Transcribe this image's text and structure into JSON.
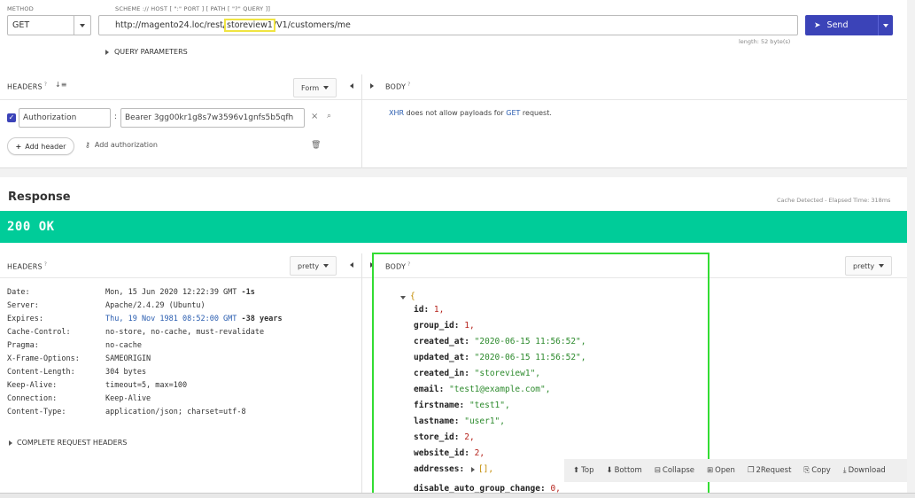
{
  "request": {
    "method_label": "METHOD",
    "method": "GET",
    "url_label": "SCHEME :// HOST [ \":\" PORT ] [ PATH [ \"?\" QUERY ]]",
    "url_prefix": "http://magento24.loc/rest/",
    "url_highlight": "storeview1",
    "url_suffix": "/V1/customers/me",
    "length": "length: 52 byte(s)",
    "send_label": "Send",
    "query_params_label": "QUERY PARAMETERS",
    "headers_label": "HEADERS",
    "headers_sup": "?",
    "form_label": "Form",
    "body_label": "BODY",
    "body_sup": "?",
    "header_name": "Authorization",
    "header_value": "Bearer 3gg00kr1g8s7w3596v1gnfs5b5qfh",
    "add_header_label": "Add header",
    "add_auth_label": "Add authorization",
    "xhr_prefix": "XHR",
    "xhr_middle": " does not allow payloads for ",
    "xhr_method": "GET",
    "xhr_suffix": " request."
  },
  "response": {
    "title": "Response",
    "cache_info": "Cache Detected - Elapsed Time: 318ms",
    "status": "200 OK",
    "headers_label": "HEADERS",
    "headers_sup": "?",
    "pretty_label": "pretty",
    "body_label": "BODY",
    "body_sup": "?",
    "headers": [
      {
        "key": "Date:",
        "value": "Mon, 15 Jun 2020 12:22:39 GMT",
        "extra": "-1s"
      },
      {
        "key": "Server:",
        "value": "Apache/2.4.29 (Ubuntu)",
        "extra": ""
      },
      {
        "key": "Expires:",
        "value": "Thu, 19 Nov 1981 08:52:00 GMT",
        "extra": "-38 years"
      },
      {
        "key": "Cache-Control:",
        "value": "no-store, no-cache, must-revalidate",
        "extra": ""
      },
      {
        "key": "Pragma:",
        "value": "no-cache",
        "extra": ""
      },
      {
        "key": "X-Frame-Options:",
        "value": "SAMEORIGIN",
        "extra": ""
      },
      {
        "key": "Content-Length:",
        "value": "304 bytes",
        "extra": ""
      },
      {
        "key": "Keep-Alive:",
        "value": "timeout=5, max=100",
        "extra": ""
      },
      {
        "key": "Connection:",
        "value": "Keep-Alive",
        "extra": ""
      },
      {
        "key": "Content-Type:",
        "value": "application/json; charset=utf-8",
        "extra": ""
      }
    ],
    "complete_headers_label": "COMPLETE REQUEST HEADERS",
    "json_open": "{",
    "json": [
      {
        "key": "id:",
        "value": "1,",
        "kind": "num"
      },
      {
        "key": "group_id:",
        "value": "1,",
        "kind": "num"
      },
      {
        "key": "created_at:",
        "value": "\"2020-06-15 11:56:52\",",
        "kind": "str"
      },
      {
        "key": "updated_at:",
        "value": "\"2020-06-15 11:56:52\",",
        "kind": "str"
      },
      {
        "key": "created_in:",
        "value": "\"storeview1\",",
        "kind": "str"
      },
      {
        "key": "email:",
        "value": "\"test1@example.com\",",
        "kind": "str"
      },
      {
        "key": "firstname:",
        "value": "\"test1\",",
        "kind": "str"
      },
      {
        "key": "lastname:",
        "value": "\"user1\",",
        "kind": "str"
      },
      {
        "key": "store_id:",
        "value": "2,",
        "kind": "num"
      },
      {
        "key": "website_id:",
        "value": "2,",
        "kind": "num"
      },
      {
        "key": "addresses:",
        "value": "[],",
        "kind": "arr"
      },
      {
        "key": "disable_auto_group_change:",
        "value": "0,",
        "kind": "num"
      }
    ],
    "toolbar": {
      "top": "Top",
      "bottom": "Bottom",
      "collapse": "Collapse",
      "open": "Open",
      "request": "2Request",
      "copy": "Copy",
      "download": "Download"
    }
  },
  "colors": {
    "accent": "#3b43b8",
    "status_ok": "#00cc99",
    "highlight_url": "#f0e442",
    "highlight_body": "#33dd33"
  }
}
